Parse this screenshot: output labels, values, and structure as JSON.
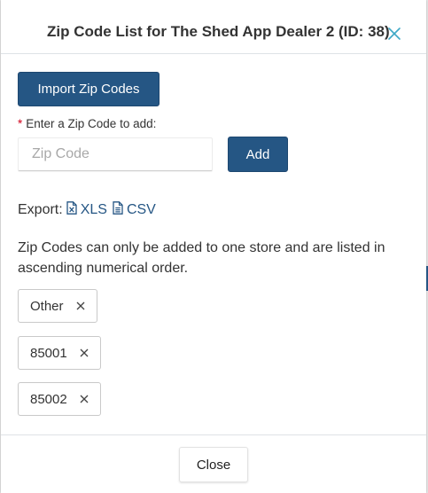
{
  "modal": {
    "title": "Zip Code List for The Shed App Dealer 2 (ID: 38)",
    "close_icon": "close-icon"
  },
  "import_button": {
    "label": "Import Zip Codes"
  },
  "zip_field": {
    "required_mark": "*",
    "label": "Enter a Zip Code to add:",
    "value": "",
    "placeholder": "Zip Code"
  },
  "add_button": {
    "label": "Add"
  },
  "export": {
    "label": "Export:",
    "xls": {
      "label": "XLS",
      "icon": "excel-file-icon"
    },
    "csv": {
      "label": "CSV",
      "icon": "csv-file-icon"
    }
  },
  "info_text": "Zip Codes can only be added to one store and are listed in ascending numerical order.",
  "zip_codes": [
    {
      "label": "Other"
    },
    {
      "label": "85001"
    },
    {
      "label": "85002"
    }
  ],
  "footer": {
    "close_label": "Close"
  },
  "colors": {
    "primary": "#255684",
    "required": "#d0021b",
    "close_icon": "#3ea8c6"
  }
}
